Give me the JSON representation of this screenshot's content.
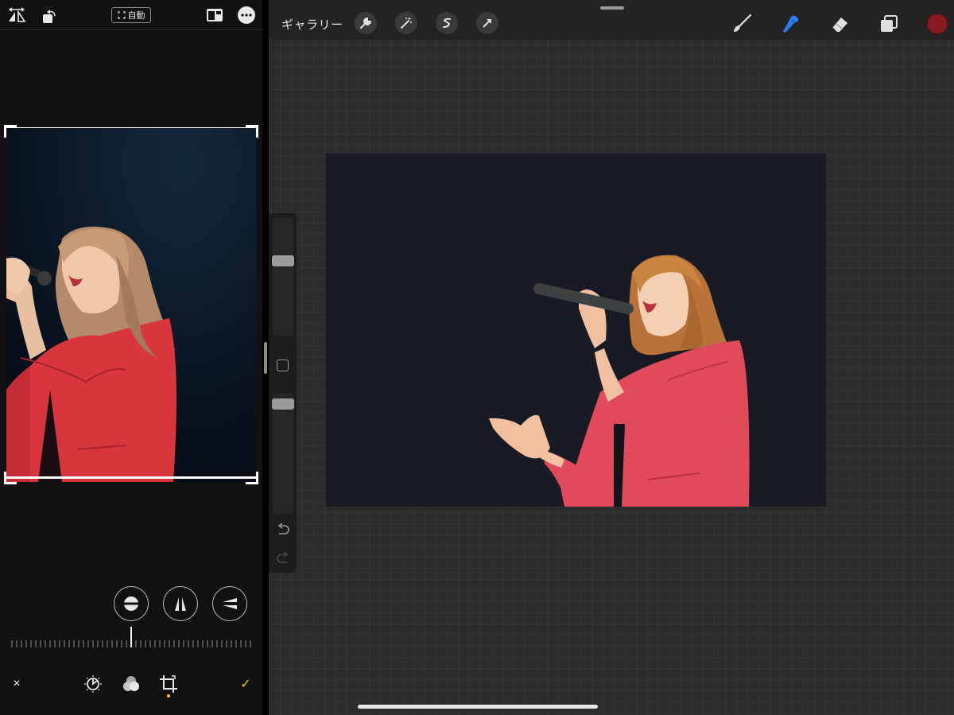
{
  "photos_editor": {
    "top_bar": {
      "auto_label": "自動",
      "flip_icon": "flip-horizontal-icon",
      "rotate_icon": "rotate-icon",
      "aspect_icon": "aspect-ratio-icon",
      "more_icon": "more-icon"
    },
    "perspective_buttons": [
      "straighten-icon",
      "vertical-perspective-icon",
      "horizontal-perspective-icon"
    ],
    "bottom_bar": {
      "cancel_label": "×",
      "done_label": "✓",
      "tools": [
        "adjust-icon",
        "filters-icon",
        "crop-icon"
      ],
      "active_tool": "crop"
    },
    "accent_color": "#ffcc00"
  },
  "procreate": {
    "top_bar": {
      "gallery_label": "ギャラリー",
      "left_tools": [
        "wrench-icon",
        "magic-wand-icon",
        "selection-icon",
        "transform-arrow-icon"
      ],
      "right_tools": [
        "brush-icon",
        "smudge-icon",
        "eraser-icon",
        "layers-icon"
      ],
      "active_tool": "smudge",
      "active_tool_color": "#2d7bf0",
      "current_color": "#8b1a1f"
    },
    "sidebar": {
      "size_slider": 0.65,
      "opacity_slider": 0.95,
      "undo_icon": "undo-icon",
      "redo_icon": "redo-icon"
    },
    "canvas_background": "#181a24"
  }
}
